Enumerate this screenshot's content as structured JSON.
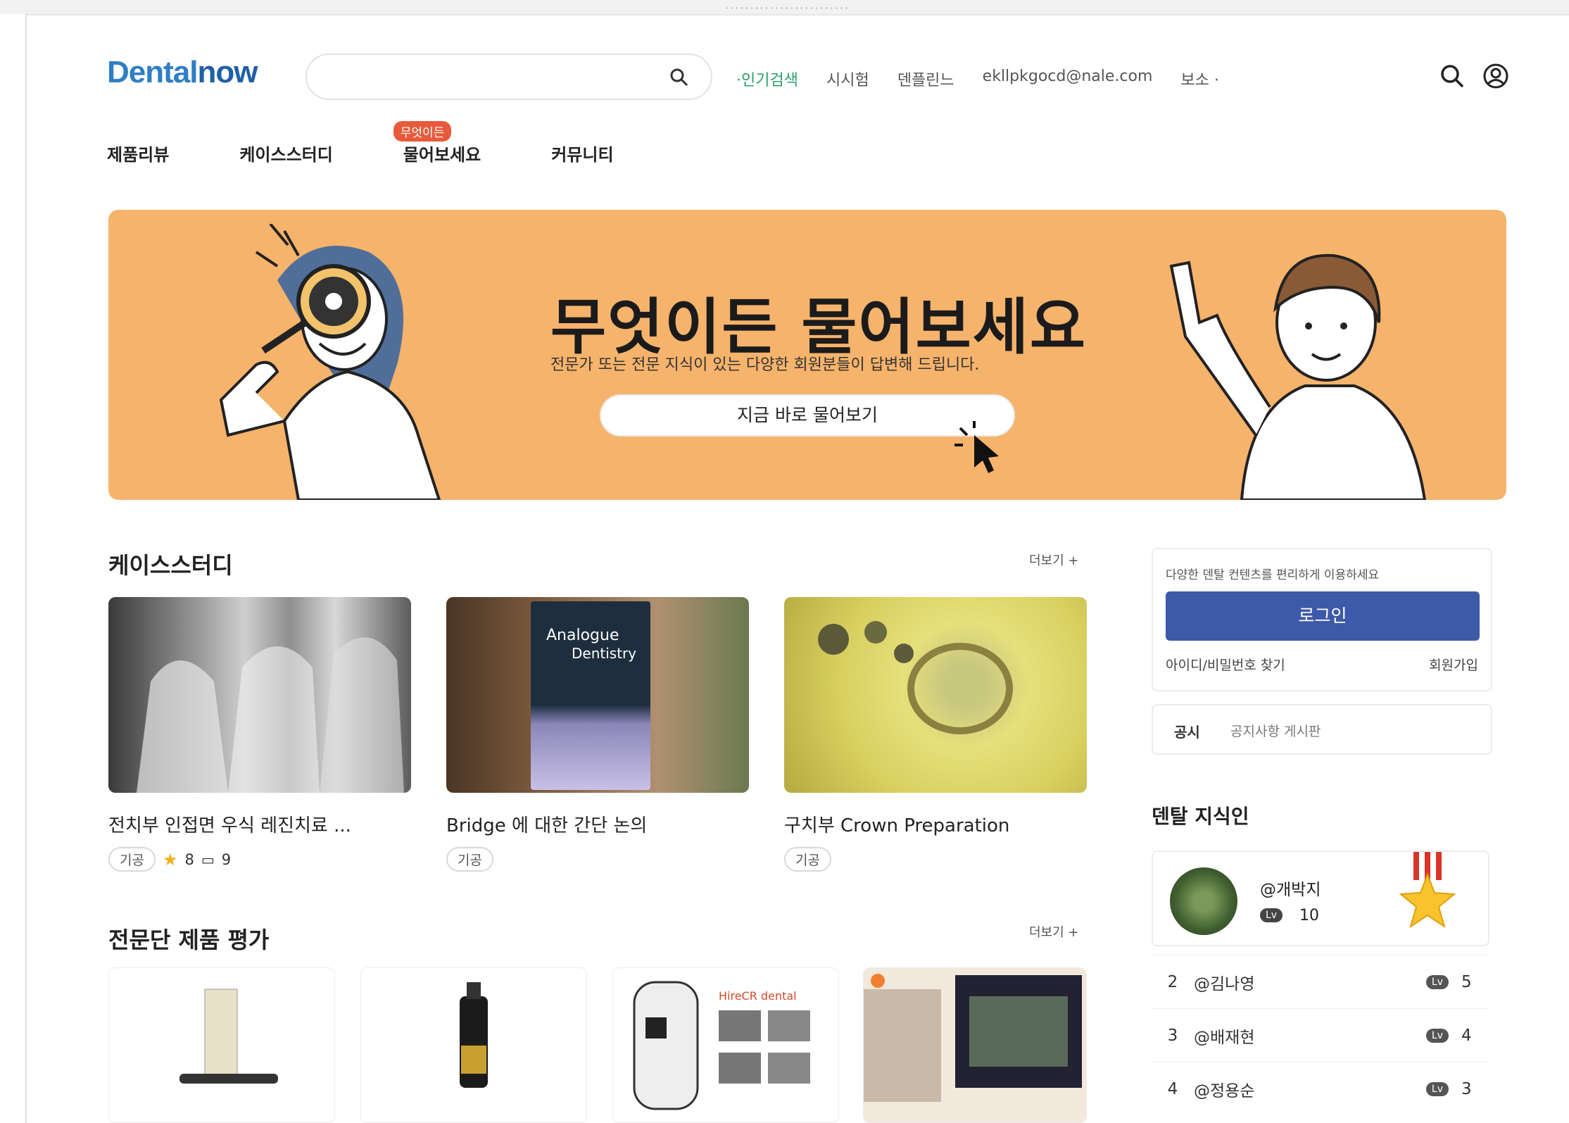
{
  "top_strip": {
    "text": "·························"
  },
  "header": {
    "logo_part1": "Dental",
    "logo_part2": "now",
    "search_placeholder": "",
    "hot_links": [
      "·인기검색",
      "시시험",
      "덴플린느",
      "ekllpkgocd@nale.com",
      "보소 ·"
    ]
  },
  "nav": {
    "items": [
      "제품리뷰",
      "케이스스터디",
      "물어보세요",
      "커뮤니티"
    ],
    "badge": "무엇이든"
  },
  "banner": {
    "title": "무엇이든 물어보세요",
    "subtitle": "전문가 또는 전문 지식이 있는 다양한 회원분들이 답변해 드립니다.",
    "cta": "지금 바로 물어보기",
    "bg_color": "#f6b36b"
  },
  "case_study": {
    "title": "케이스스터디",
    "more": "더보기 +",
    "cards": [
      {
        "title": "전치부 인접면 우식 레진치료 ...",
        "tag": "기공",
        "stars": "8",
        "comments": "9"
      },
      {
        "title": "Bridge 에 대한 간단 논의",
        "tag": "기공",
        "book_line1": "Analogue",
        "book_line2": "Dentistry"
      },
      {
        "title": "구치부 Crown Preparation",
        "tag": "기공"
      }
    ]
  },
  "product_review": {
    "title": "전문단 제품 평가",
    "more": "더보기 +",
    "card3_brand": "HireCR dental"
  },
  "sidebar": {
    "login_hint": "다양한 덴탈 컨텐츠를 편리하게 이용하세요",
    "login_button": "로그인",
    "find_account": "아이디/비밀번호 찾기",
    "signup": "회원가입",
    "notice_label": "공시",
    "notice_text": "공지사항 게시판",
    "knowledge_title": "덴탈 지식인",
    "top_user": {
      "name": "@개박지",
      "level": "Lv",
      "points": "10"
    },
    "ranks": [
      {
        "rank": "2",
        "name": "@김나영",
        "level": "Lv",
        "points": "5"
      },
      {
        "rank": "3",
        "name": "@배재현",
        "level": "Lv",
        "points": "4"
      },
      {
        "rank": "4",
        "name": "@정용순",
        "level": "Lv",
        "points": "3"
      }
    ]
  }
}
